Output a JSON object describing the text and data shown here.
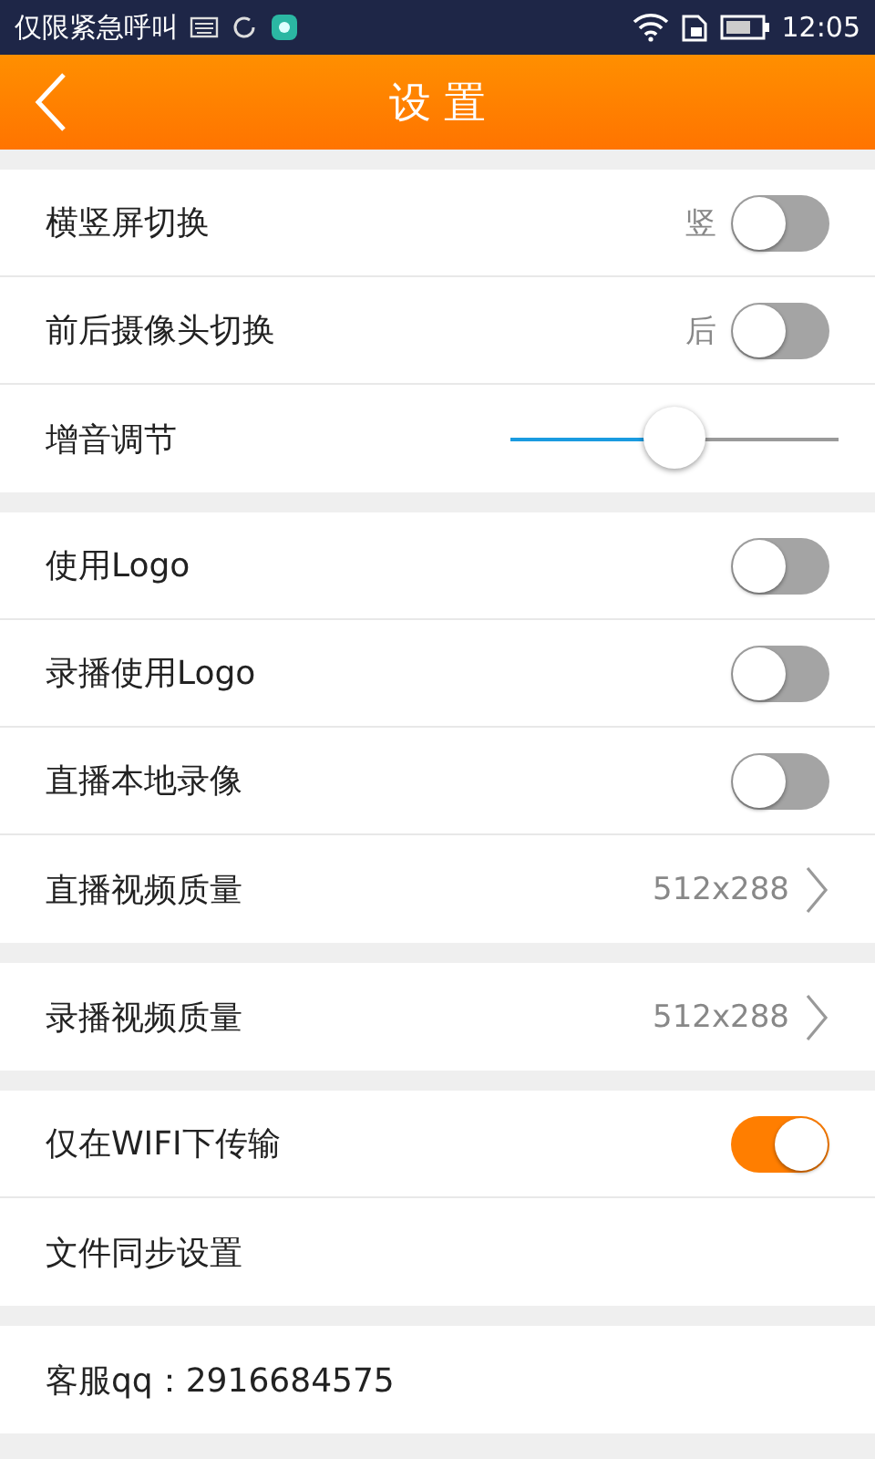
{
  "status_bar": {
    "carrier": "仅限紧急呼叫",
    "time": "12:05"
  },
  "header": {
    "title": "设 置"
  },
  "sections": [
    {
      "rows": [
        {
          "kind": "toggle",
          "label": "横竖屏切换",
          "value": "竖",
          "on": false
        },
        {
          "kind": "toggle",
          "label": "前后摄像头切换",
          "value": "后",
          "on": false
        },
        {
          "kind": "slider",
          "label": "增音调节",
          "level": 0.5
        }
      ]
    },
    {
      "rows": [
        {
          "kind": "toggle",
          "label": "使用Logo",
          "on": false
        },
        {
          "kind": "toggle",
          "label": "录播使用Logo",
          "on": false
        },
        {
          "kind": "toggle",
          "label": "直播本地录像",
          "on": false
        },
        {
          "kind": "nav",
          "label": "直播视频质量",
          "value": "512x288"
        }
      ]
    },
    {
      "rows": [
        {
          "kind": "nav",
          "label": "录播视频质量",
          "value": "512x288"
        }
      ]
    },
    {
      "rows": [
        {
          "kind": "toggle",
          "label": "仅在WIFI下传输",
          "on": true
        },
        {
          "kind": "plain",
          "label": "文件同步设置"
        }
      ]
    },
    {
      "rows": [
        {
          "kind": "plain",
          "label": "客服qq：2916684575"
        }
      ]
    }
  ]
}
